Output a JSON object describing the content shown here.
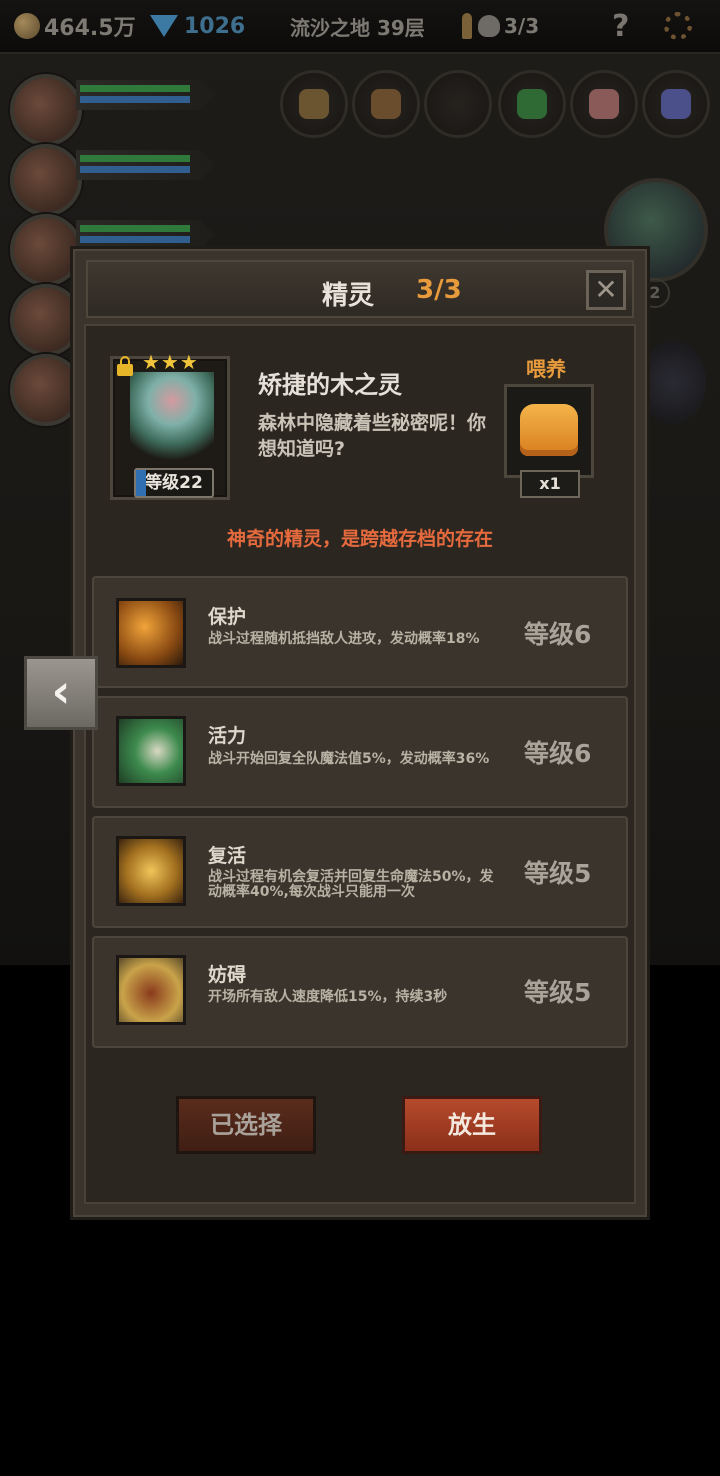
{
  "topbar": {
    "gold": "464.5万",
    "gems": "1026",
    "location": "流沙之地 39层",
    "keys_skulls": "3/3",
    "help": "?"
  },
  "modal": {
    "title": "精灵",
    "count": "3/3",
    "close": "✕"
  },
  "spirit": {
    "stars": "★★★",
    "level": "等级22",
    "name": "矫捷的木之灵",
    "description": "森林中隐藏着些秘密呢！你想知道吗?"
  },
  "feed": {
    "label": "喂养",
    "count": "x1"
  },
  "tagline": "神奇的精灵，是跨越存档的存在",
  "skills": [
    {
      "name": "保护",
      "desc": "战斗过程随机抵挡敌人进攻，发动概率18%",
      "level": "等级6"
    },
    {
      "name": "活力",
      "desc": "战斗开始回复全队魔法值5%，发动概率36%",
      "level": "等级6"
    },
    {
      "name": "复活",
      "desc": "战斗过程有机会复活并回复生命魔法50%，发动概率40%,每次战斗只能用一次",
      "level": "等级5"
    },
    {
      "name": "妨碍",
      "desc": "开场所有敌人速度降低15%，持续3秒",
      "level": "等级5"
    }
  ],
  "side": {
    "badge": "2"
  },
  "nav": {
    "back": "‹"
  },
  "buttons": {
    "selected": "已选择",
    "release": "放生"
  }
}
